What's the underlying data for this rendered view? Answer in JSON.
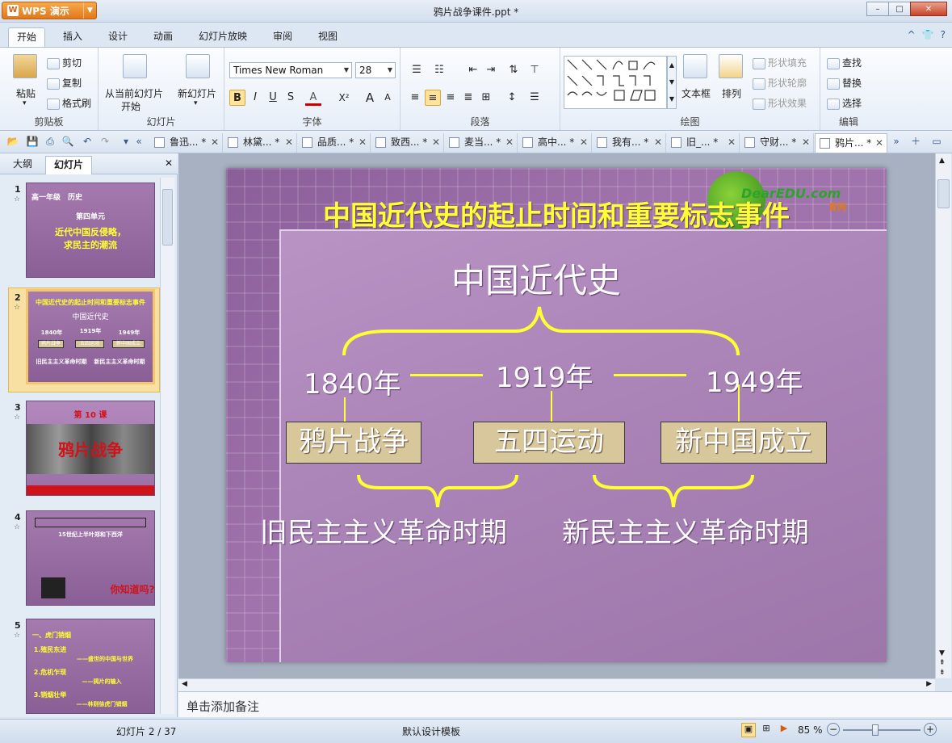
{
  "window": {
    "app_name": "WPS 演示",
    "title": "鸦片战争课件.ppt *",
    "controls": [
      "–",
      "□",
      "✕"
    ]
  },
  "ribbon": {
    "tabs": [
      "开始",
      "插入",
      "设计",
      "动画",
      "幻灯片放映",
      "审阅",
      "视图"
    ],
    "active_tab": "开始",
    "right_icons": [
      "^",
      "👕",
      "?"
    ],
    "clipboard": {
      "label": "剪贴板",
      "paste": "粘贴",
      "cut": "剪切",
      "copy": "复制",
      "format_painter": "格式刷"
    },
    "slides": {
      "label": "幻灯片",
      "from_current_1": "从当前幻灯片",
      "from_current_2": "开始",
      "new_slide": "新幻灯片"
    },
    "font": {
      "label": "字体",
      "font_name": "Times New Roman",
      "font_size": "28",
      "bold": "B",
      "italic": "I",
      "underline": "U",
      "shadow": "S",
      "font_color": "A",
      "sup": "X²",
      "grow": "A",
      "shrink": "A"
    },
    "paragraph": {
      "label": "段落"
    },
    "drawing": {
      "label": "绘图",
      "textbox": "文本框",
      "arrange": "排列",
      "shape_fill": "形状填充",
      "shape_outline": "形状轮廓",
      "shape_effect": "形状效果"
    },
    "editing": {
      "label": "编辑",
      "find": "查找",
      "replace": "替换",
      "select": "选择"
    }
  },
  "doc_tabs": [
    {
      "label": "鲁迅... *"
    },
    {
      "label": "林黛... *"
    },
    {
      "label": "品质... *"
    },
    {
      "label": "致西... *"
    },
    {
      "label": "麦当... *"
    },
    {
      "label": "高中... *"
    },
    {
      "label": "我有... *"
    },
    {
      "label": "旧_... *"
    },
    {
      "label": "守财... *"
    },
    {
      "label": "鸦片... *"
    }
  ],
  "left_panel": {
    "tabs": [
      "大纲",
      "幻灯片"
    ],
    "active_tab": "幻灯片",
    "close": "✕",
    "thumbnails": [
      {
        "num": "1",
        "lines": [
          "高一年级　历史",
          "第四单元",
          "近代中国反侵略，",
          "求民主的潮流"
        ]
      },
      {
        "num": "2",
        "lines": [
          "中国近代史的起止时间和重要标志事件",
          "中国近代史",
          "1840年",
          "1919年",
          "1949年",
          "鸦片战争",
          "五四运动",
          "新中国成立",
          "旧民主主义革命时期",
          "新民主主义革命时期"
        ]
      },
      {
        "num": "3",
        "lines": [
          "第 10 课",
          "鸦片战争"
        ]
      },
      {
        "num": "4",
        "lines": [
          "15世纪上半叶郑和下西洋",
          "你知道吗?"
        ]
      },
      {
        "num": "5",
        "lines": [
          "一、虎门销烟",
          "1.殖民东进",
          "——盛世的中国与世界",
          "2.危机乍现",
          "——鸦片的输入",
          "3.销烟壮举",
          "——林则徐虎门销烟"
        ]
      }
    ]
  },
  "slide": {
    "title": "中国近代史的起止时间和重要标志事件",
    "logo_text": "DearEDU.com",
    "logo_sub": "育网",
    "heading": "中国近代史",
    "years": [
      "1840年",
      "1919年",
      "1949年"
    ],
    "events": [
      "鸦片战争",
      "五四运动",
      "新中国成立"
    ],
    "periods": [
      "旧民主主义革命时期",
      "新民主主义革命时期"
    ]
  },
  "notes": {
    "placeholder": "单击添加备注"
  },
  "status": {
    "slide_counter": "幻灯片 2 / 37",
    "template": "默认设计模板",
    "zoom": "85 %"
  }
}
